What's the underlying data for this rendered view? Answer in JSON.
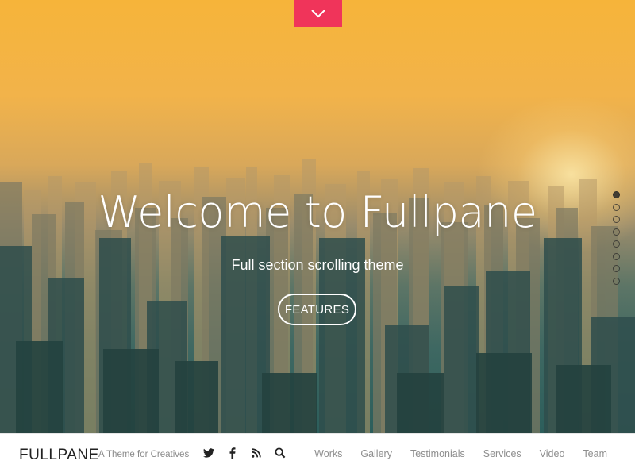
{
  "hero": {
    "title": "Welcome to Fullpane",
    "subtitle": "Full section scrolling theme",
    "cta_label": "FEATURES",
    "scroll_icon": "chevron-down-icon",
    "accent_color": "#f0345a"
  },
  "dot_nav": {
    "count": 8,
    "active_index": 0
  },
  "footer": {
    "brand": "FULLPANE",
    "tagline": "A Theme for Creatives",
    "social_icons": [
      "twitter-icon",
      "facebook-icon",
      "rss-icon",
      "search-icon"
    ],
    "nav_items": [
      "Works",
      "Gallery",
      "Testimonials",
      "Services",
      "Video",
      "Team"
    ]
  }
}
